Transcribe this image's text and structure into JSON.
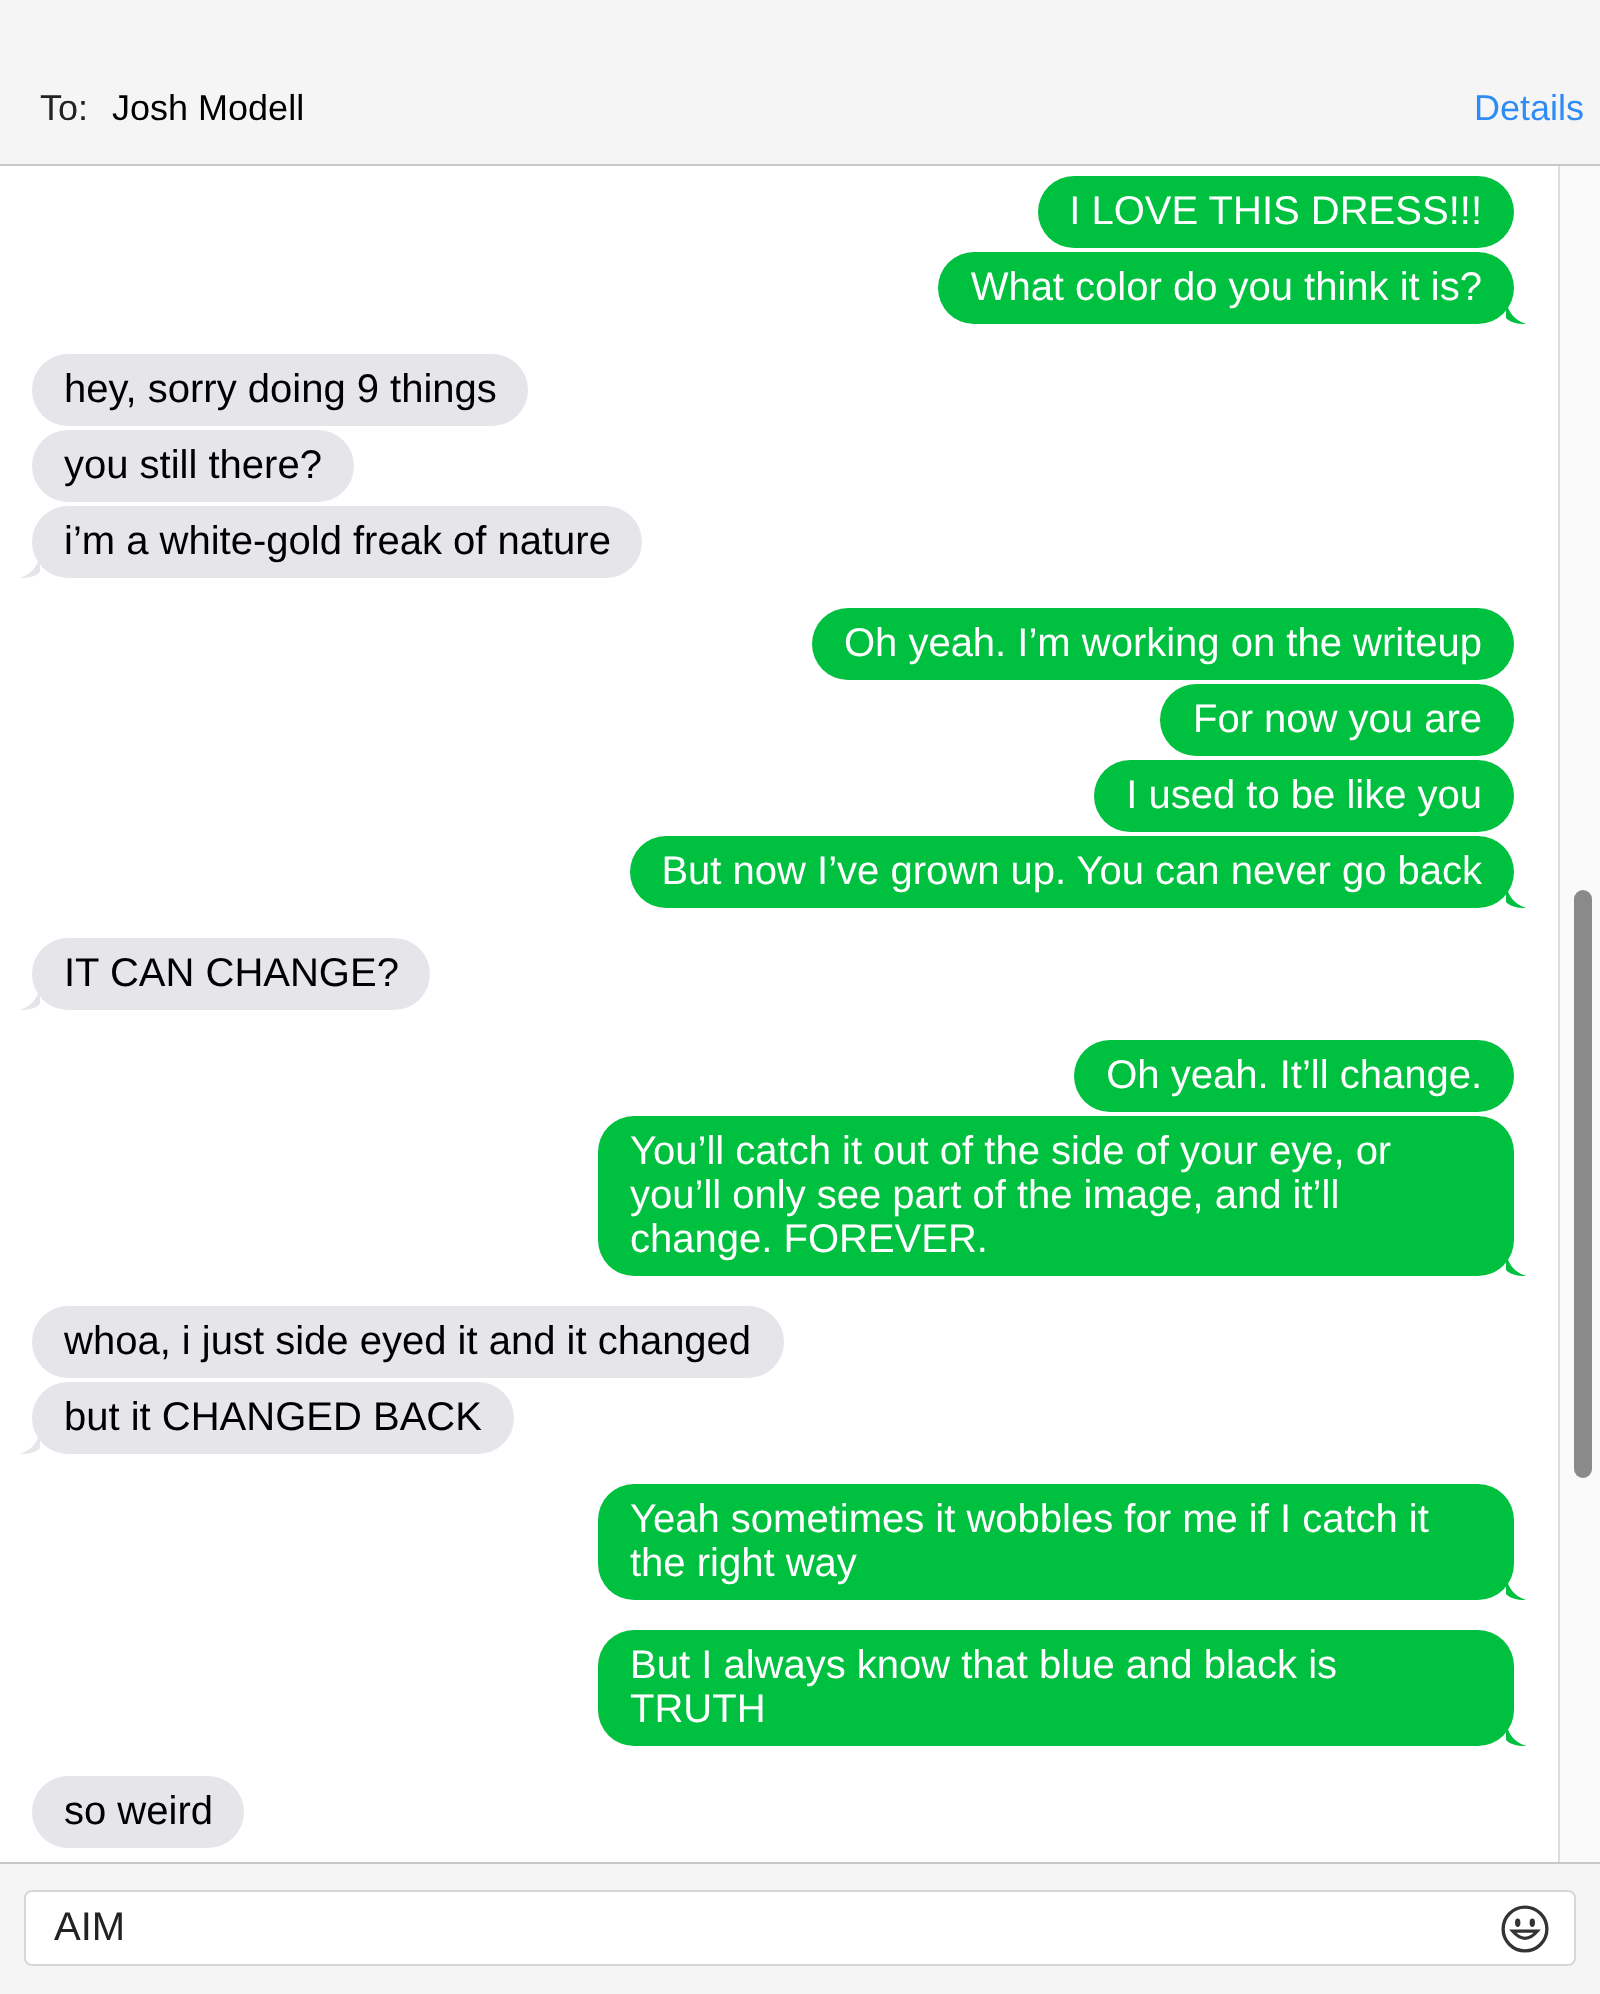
{
  "header": {
    "to_label": "To:",
    "recipient": "Josh Modell",
    "details_link": "Details"
  },
  "messages": [
    {
      "kind": "sent",
      "text": "I LOVE THIS DRESS!!!",
      "tail": false
    },
    {
      "kind": "sent",
      "text": "What color do you think it is?",
      "tail": true
    },
    {
      "kind": "received",
      "text": "hey, sorry doing 9 things",
      "tail": false
    },
    {
      "kind": "received",
      "text": "you still there?",
      "tail": false
    },
    {
      "kind": "received",
      "text": "i’m a white-gold freak of nature",
      "tail": true
    },
    {
      "kind": "sent",
      "text": "Oh yeah. I’m working on the writeup",
      "tail": false
    },
    {
      "kind": "sent",
      "text": "For now you are",
      "tail": false
    },
    {
      "kind": "sent",
      "text": "I used to be like you",
      "tail": false
    },
    {
      "kind": "sent",
      "text": "But now I’ve grown up. You can never go back",
      "tail": true
    },
    {
      "kind": "received",
      "text": "IT CAN CHANGE?",
      "tail": true
    },
    {
      "kind": "sent",
      "text": "Oh yeah. It’ll change.",
      "tail": false
    },
    {
      "kind": "sent",
      "text": "You’ll catch it out of the side of your eye, or you’ll only see part of the image, and it’ll change. FOREVER.",
      "tail": true
    },
    {
      "kind": "received",
      "text": "whoa, i just side eyed it and it changed",
      "tail": false
    },
    {
      "kind": "received",
      "text": "but it CHANGED BACK",
      "tail": true
    },
    {
      "kind": "sent",
      "text": "Yeah sometimes it wobbles for me if I catch it the right way",
      "tail": true
    },
    {
      "kind": "sent",
      "text": "But I always know that blue and black is TRUTH",
      "tail": true
    },
    {
      "kind": "received",
      "text": "so weird",
      "tail": false
    }
  ],
  "composer": {
    "value": "AIM"
  }
}
